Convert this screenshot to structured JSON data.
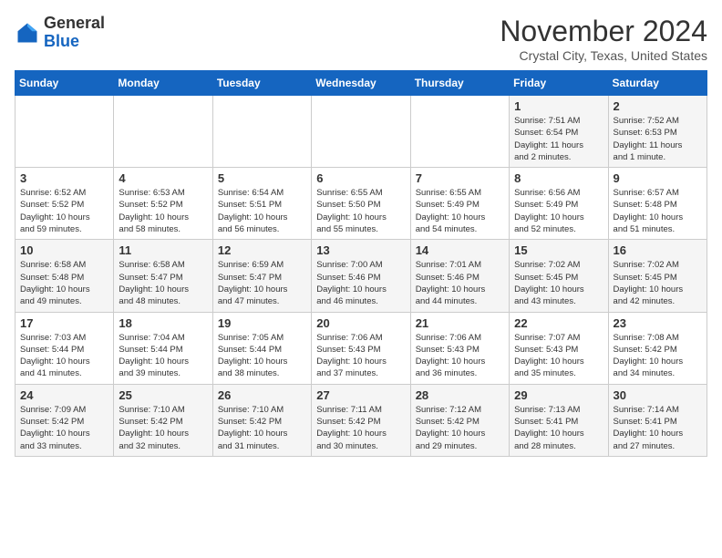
{
  "header": {
    "logo": {
      "general": "General",
      "blue": "Blue"
    },
    "month": "November 2024",
    "location": "Crystal City, Texas, United States"
  },
  "weekdays": [
    "Sunday",
    "Monday",
    "Tuesday",
    "Wednesday",
    "Thursday",
    "Friday",
    "Saturday"
  ],
  "weeks": [
    [
      {
        "day": "",
        "info": ""
      },
      {
        "day": "",
        "info": ""
      },
      {
        "day": "",
        "info": ""
      },
      {
        "day": "",
        "info": ""
      },
      {
        "day": "",
        "info": ""
      },
      {
        "day": "1",
        "info": "Sunrise: 7:51 AM\nSunset: 6:54 PM\nDaylight: 11 hours\nand 2 minutes."
      },
      {
        "day": "2",
        "info": "Sunrise: 7:52 AM\nSunset: 6:53 PM\nDaylight: 11 hours\nand 1 minute."
      }
    ],
    [
      {
        "day": "3",
        "info": "Sunrise: 6:52 AM\nSunset: 5:52 PM\nDaylight: 10 hours\nand 59 minutes."
      },
      {
        "day": "4",
        "info": "Sunrise: 6:53 AM\nSunset: 5:52 PM\nDaylight: 10 hours\nand 58 minutes."
      },
      {
        "day": "5",
        "info": "Sunrise: 6:54 AM\nSunset: 5:51 PM\nDaylight: 10 hours\nand 56 minutes."
      },
      {
        "day": "6",
        "info": "Sunrise: 6:55 AM\nSunset: 5:50 PM\nDaylight: 10 hours\nand 55 minutes."
      },
      {
        "day": "7",
        "info": "Sunrise: 6:55 AM\nSunset: 5:49 PM\nDaylight: 10 hours\nand 54 minutes."
      },
      {
        "day": "8",
        "info": "Sunrise: 6:56 AM\nSunset: 5:49 PM\nDaylight: 10 hours\nand 52 minutes."
      },
      {
        "day": "9",
        "info": "Sunrise: 6:57 AM\nSunset: 5:48 PM\nDaylight: 10 hours\nand 51 minutes."
      }
    ],
    [
      {
        "day": "10",
        "info": "Sunrise: 6:58 AM\nSunset: 5:48 PM\nDaylight: 10 hours\nand 49 minutes."
      },
      {
        "day": "11",
        "info": "Sunrise: 6:58 AM\nSunset: 5:47 PM\nDaylight: 10 hours\nand 48 minutes."
      },
      {
        "day": "12",
        "info": "Sunrise: 6:59 AM\nSunset: 5:47 PM\nDaylight: 10 hours\nand 47 minutes."
      },
      {
        "day": "13",
        "info": "Sunrise: 7:00 AM\nSunset: 5:46 PM\nDaylight: 10 hours\nand 46 minutes."
      },
      {
        "day": "14",
        "info": "Sunrise: 7:01 AM\nSunset: 5:46 PM\nDaylight: 10 hours\nand 44 minutes."
      },
      {
        "day": "15",
        "info": "Sunrise: 7:02 AM\nSunset: 5:45 PM\nDaylight: 10 hours\nand 43 minutes."
      },
      {
        "day": "16",
        "info": "Sunrise: 7:02 AM\nSunset: 5:45 PM\nDaylight: 10 hours\nand 42 minutes."
      }
    ],
    [
      {
        "day": "17",
        "info": "Sunrise: 7:03 AM\nSunset: 5:44 PM\nDaylight: 10 hours\nand 41 minutes."
      },
      {
        "day": "18",
        "info": "Sunrise: 7:04 AM\nSunset: 5:44 PM\nDaylight: 10 hours\nand 39 minutes."
      },
      {
        "day": "19",
        "info": "Sunrise: 7:05 AM\nSunset: 5:44 PM\nDaylight: 10 hours\nand 38 minutes."
      },
      {
        "day": "20",
        "info": "Sunrise: 7:06 AM\nSunset: 5:43 PM\nDaylight: 10 hours\nand 37 minutes."
      },
      {
        "day": "21",
        "info": "Sunrise: 7:06 AM\nSunset: 5:43 PM\nDaylight: 10 hours\nand 36 minutes."
      },
      {
        "day": "22",
        "info": "Sunrise: 7:07 AM\nSunset: 5:43 PM\nDaylight: 10 hours\nand 35 minutes."
      },
      {
        "day": "23",
        "info": "Sunrise: 7:08 AM\nSunset: 5:42 PM\nDaylight: 10 hours\nand 34 minutes."
      }
    ],
    [
      {
        "day": "24",
        "info": "Sunrise: 7:09 AM\nSunset: 5:42 PM\nDaylight: 10 hours\nand 33 minutes."
      },
      {
        "day": "25",
        "info": "Sunrise: 7:10 AM\nSunset: 5:42 PM\nDaylight: 10 hours\nand 32 minutes."
      },
      {
        "day": "26",
        "info": "Sunrise: 7:10 AM\nSunset: 5:42 PM\nDaylight: 10 hours\nand 31 minutes."
      },
      {
        "day": "27",
        "info": "Sunrise: 7:11 AM\nSunset: 5:42 PM\nDaylight: 10 hours\nand 30 minutes."
      },
      {
        "day": "28",
        "info": "Sunrise: 7:12 AM\nSunset: 5:42 PM\nDaylight: 10 hours\nand 29 minutes."
      },
      {
        "day": "29",
        "info": "Sunrise: 7:13 AM\nSunset: 5:41 PM\nDaylight: 10 hours\nand 28 minutes."
      },
      {
        "day": "30",
        "info": "Sunrise: 7:14 AM\nSunset: 5:41 PM\nDaylight: 10 hours\nand 27 minutes."
      }
    ]
  ]
}
